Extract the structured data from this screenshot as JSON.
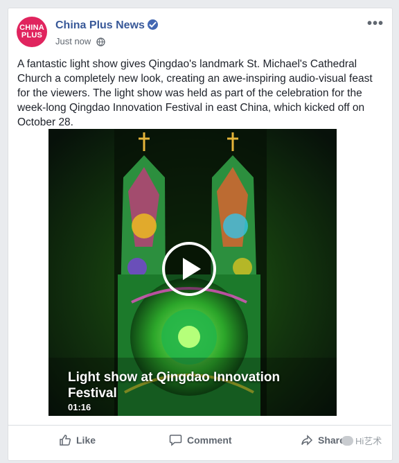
{
  "post": {
    "page_name": "China Plus News",
    "avatar_text_line1": "CHINA",
    "avatar_text_line2": "PLUS",
    "timestamp": "Just now",
    "menu_label": "•••",
    "text": "A fantastic light show gives Qingdao's landmark St. Michael's Cathedral Church a completely new look, creating an awe-inspiring audio-visual feast for the viewers. The light show was held as part of the celebration for the week-long Qingdao Innovation Festival in east China, which kicked off on October 28."
  },
  "video": {
    "title": "Light show at Qingdao Innovation Festival",
    "duration": "01:16"
  },
  "actions": {
    "like": "Like",
    "comment": "Comment",
    "share": "Share"
  },
  "watermark": "Hi艺术",
  "colors": {
    "brand_pink": "#e0245e",
    "link_blue": "#385898",
    "verified_blue": "#4267b2",
    "secondary_text": "#606770"
  },
  "icons": [
    "verified-badge-icon",
    "globe-icon",
    "more-options-icon",
    "play-icon",
    "like-icon",
    "comment-icon",
    "share-icon",
    "wechat-icon"
  ]
}
